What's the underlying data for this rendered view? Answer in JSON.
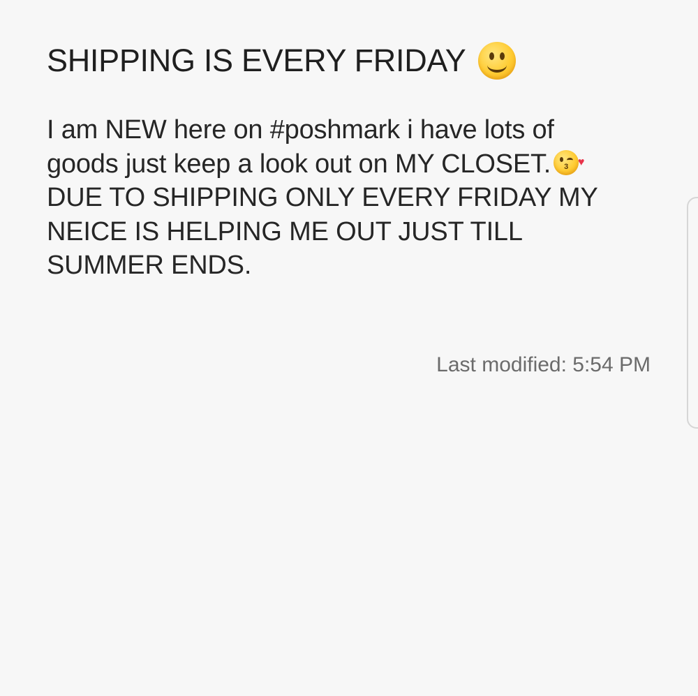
{
  "note": {
    "title": "SHIPPING IS EVERY FRIDAY",
    "title_icon": "slightly-smiling-face-emoji",
    "body_lines": [
      " I am NEW here on #poshmark i have lots of",
      "goods just keep a look out on MY CLOSET.",
      "DUE TO SHIPPING ONLY EVERY FRIDAY MY",
      "NEICE IS HELPING ME OUT JUST TILL",
      "SUMMER ENDS."
    ],
    "inline_icon": "face-blowing-a-kiss-emoji",
    "last_modified": "Last modified: 5:54 PM"
  },
  "colors": {
    "background": "#f7f7f7",
    "title_text": "#1f1f1f",
    "body_text": "#262626",
    "meta_text": "#6b6b6b",
    "emoji_yellow": "#ffcc33"
  }
}
